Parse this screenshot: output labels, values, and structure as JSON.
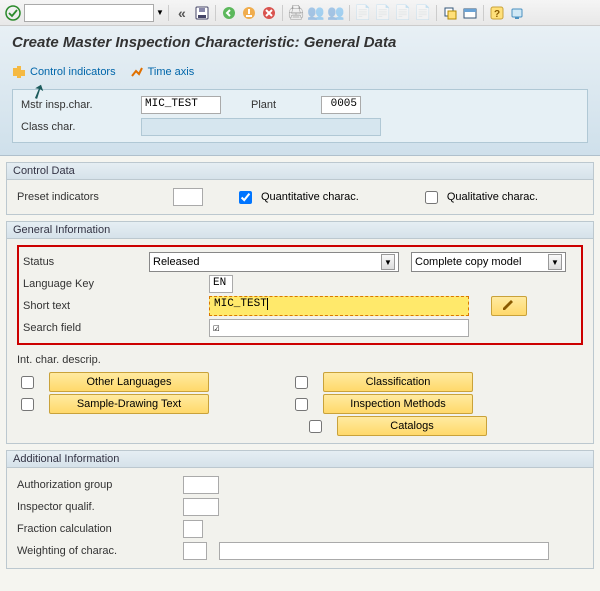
{
  "toolbar": {
    "ok_icon": "ok-circle",
    "dropdown": "",
    "back_icon": "«",
    "save_icon": "save",
    "g1": "●",
    "g2": "●",
    "g3": "●",
    "help_icon": "?"
  },
  "page": {
    "title": "Create Master Inspection Characteristic: General Data"
  },
  "subtabs": {
    "control": "Control indicators",
    "time": "Time axis"
  },
  "keys": {
    "mic_label": "Mstr insp.char.",
    "mic_value": "MIC_TEST",
    "plant_label": "Plant",
    "plant_value": "0005",
    "class_label": "Class char."
  },
  "control_data": {
    "title": "Control Data",
    "preset_label": "Preset indicators",
    "quant_label": "Quantitative charac.",
    "qual_label": "Qualitative charac."
  },
  "general": {
    "title": "General Information",
    "status_label": "Status",
    "status_value": "Released",
    "copy_model": "Complete copy model",
    "lang_label": "Language Key",
    "lang_value": "EN",
    "short_label": "Short text",
    "short_value": "MIC_TEST",
    "search_label": "Search field",
    "intchar_label": "Int. char. descrip.",
    "btn_other_lang": "Other Languages",
    "btn_sample": "Sample-Drawing Text",
    "btn_class": "Classification",
    "btn_insp": "Inspection Methods",
    "btn_cat": "Catalogs"
  },
  "additional": {
    "title": "Additional Information",
    "auth_label": "Authorization group",
    "insp_label": "Inspector qualif.",
    "frac_label": "Fraction calculation",
    "weight_label": "Weighting of charac."
  }
}
